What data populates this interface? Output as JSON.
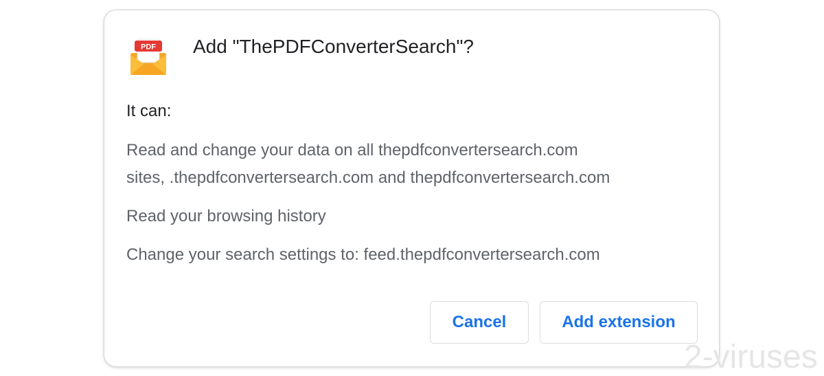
{
  "dialog": {
    "title": "Add \"ThePDFConverterSearch\"?",
    "icon": {
      "name": "pdf-envelope-icon",
      "label": "PDF"
    },
    "intro": "It can:",
    "permissions": [
      "Read and change your data on all thepdfconvertersearch.com sites, .thepdfconvertersearch.com and thepdfconvertersearch.com",
      "Read your browsing history",
      "Change your search settings to: feed.thepdfconvertersearch.com"
    ],
    "permission_1_lines": [
      "Read and change your data on all thepdfconvertersearch.com",
      "sites, .thepdfconvertersearch.com and thepdfconvertersearch.com"
    ],
    "buttons": {
      "cancel": "Cancel",
      "add": "Add extension"
    }
  },
  "watermark": "2-viruses",
  "colors": {
    "accent": "#1a73e8",
    "title_text": "#202124",
    "body_text": "#5f6368",
    "border": "#dadce0",
    "icon_red": "#e53935",
    "icon_yellow": "#f9b233"
  }
}
